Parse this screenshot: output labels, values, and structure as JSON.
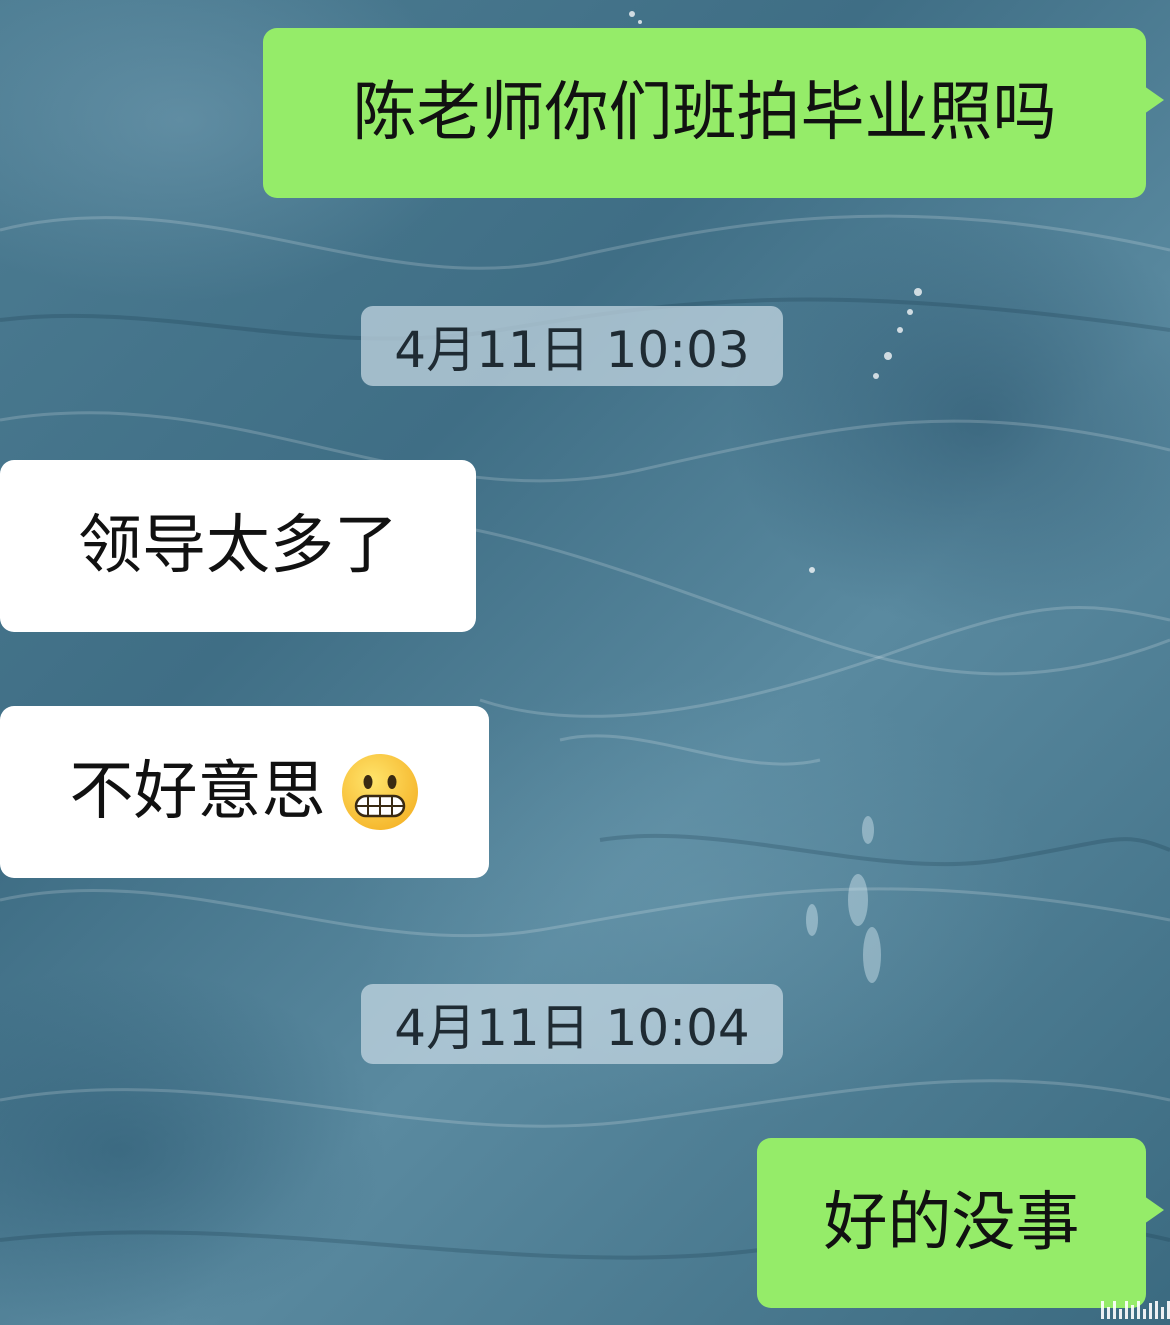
{
  "chat": {
    "messages": [
      {
        "id": "m1",
        "side": "sent",
        "text": "陈老师你们班拍毕业照吗"
      },
      {
        "id": "m2",
        "side": "received",
        "text": "领导太多了"
      },
      {
        "id": "m3",
        "side": "received",
        "text": "不好意思",
        "emoji": "grimacing-face-icon"
      },
      {
        "id": "m4",
        "side": "sent",
        "text": "好的没事"
      }
    ],
    "timestamps": [
      {
        "id": "t1",
        "text": "4月11日 10:03"
      },
      {
        "id": "t2",
        "text": "4月11日 10:04"
      }
    ]
  },
  "colors": {
    "sent_bubble": "#95ec69",
    "received_bubble": "#ffffff",
    "background": "#4d7d93"
  }
}
